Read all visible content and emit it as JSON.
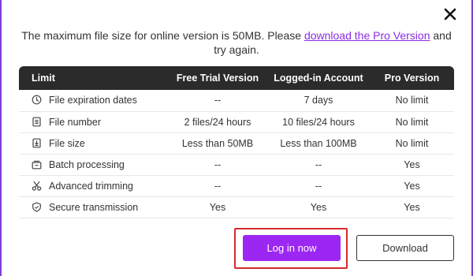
{
  "dialog": {
    "close_icon": "close-icon",
    "message": {
      "text_before": "The maximum file size for online version is 50MB. Please ",
      "link_text": "download the Pro Version",
      "text_after": " and try again."
    }
  },
  "table": {
    "headers": [
      "Limit",
      "Free Trial Version",
      "Logged-in Account",
      "Pro Version"
    ],
    "rows": [
      {
        "icon": "clock-icon",
        "feature": "File expiration dates",
        "trial": "--",
        "logged": "7 days",
        "pro": "No limit"
      },
      {
        "icon": "file-number-icon",
        "feature": "File number",
        "trial": "2 files/24 hours",
        "logged": "10 files/24 hours",
        "pro": "No limit"
      },
      {
        "icon": "file-size-icon",
        "feature": "File size",
        "trial": "Less than 50MB",
        "logged": "Less than 100MB",
        "pro": "No limit"
      },
      {
        "icon": "batch-processing-icon",
        "feature": "Batch processing",
        "trial": "--",
        "logged": "--",
        "pro": "Yes"
      },
      {
        "icon": "scissors-icon",
        "feature": "Advanced trimming",
        "trial": "--",
        "logged": "--",
        "pro": "Yes"
      },
      {
        "icon": "shield-icon",
        "feature": "Secure transmission",
        "trial": "Yes",
        "logged": "Yes",
        "pro": "Yes"
      }
    ]
  },
  "buttons": {
    "login_label": "Log in now",
    "download_label": "Download"
  },
  "colors": {
    "accent_purple": "#9d27f2",
    "link_purple": "#8a2be2",
    "dash_orange": "#f0a020",
    "highlight_red": "#d52b2b",
    "header_dark": "#2b2b2b"
  }
}
